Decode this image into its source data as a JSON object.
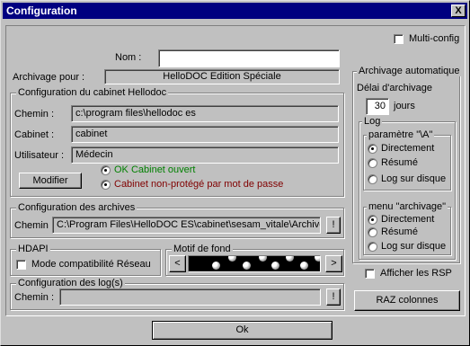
{
  "window": {
    "title": "Configuration",
    "close_glyph": "X"
  },
  "multi_config": {
    "label": "Multi-config",
    "checked": false
  },
  "nom": {
    "label": "Nom :",
    "value": ""
  },
  "archivage_pour": {
    "label": "Archivage pour :",
    "value": "HelloDOC Edition Spéciale"
  },
  "cabinet": {
    "title": "Configuration du cabinet Hellodoc",
    "chemin_label": "Chemin :",
    "chemin_value": "c:\\program files\\hellodoc es",
    "cabinet_label": "Cabinet :",
    "cabinet_value": "cabinet",
    "user_label": "Utilisateur :",
    "user_value": "Médecin",
    "modifier": "Modifier",
    "status_open": "OK Cabinet ouvert",
    "status_unprotected": "Cabinet non-protégé par mot de passe",
    "status_open_color": "#008000",
    "status_unprotected_color": "#800000"
  },
  "archives": {
    "title": "Configuration des archives",
    "chemin_label": "Chemin :",
    "chemin_value": "C:\\Program Files\\HelloDOC ES\\cabinet\\sesam_vitale\\Archive",
    "browse": "!"
  },
  "hdapi": {
    "title": "HDAPI",
    "mode_label": "Mode compatibilité Réseau",
    "checked": false
  },
  "motif": {
    "title": "Motif de fond",
    "prev": "<",
    "next": ">"
  },
  "logs": {
    "title": "Configuration des log(s)",
    "chemin_label": "Chemin :",
    "chemin_value": "",
    "browse": "!"
  },
  "auto": {
    "title": "Archivage automatique",
    "delai_label": "Délai d'archivage",
    "delai_value": "30",
    "delai_unit": "jours",
    "log_title": "Log",
    "param_a_title": "paramètre \"\\A\"",
    "param_a_options": [
      "Directement",
      "Résumé",
      "Log sur disque"
    ],
    "param_a_selected": 0,
    "menu_title": "menu \"archivage\"",
    "menu_options": [
      "Directement",
      "Résumé",
      "Log sur disque"
    ],
    "menu_selected": 0
  },
  "afficher_rsp": {
    "label": "Afficher les RSP",
    "checked": false
  },
  "raz": "RAZ colonnes",
  "ok": "Ok"
}
